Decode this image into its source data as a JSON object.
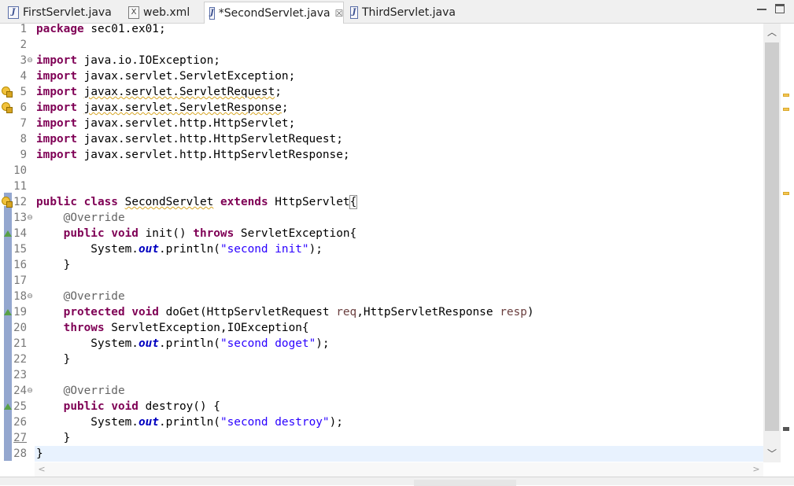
{
  "tabs": [
    {
      "label": "FirstServlet.java",
      "icon": "java-file-icon",
      "glyph": "J",
      "active": false
    },
    {
      "label": "web.xml",
      "icon": "xml-file-icon",
      "glyph": "X",
      "active": false
    },
    {
      "label": "*SecondServlet.java",
      "icon": "java-file-icon",
      "glyph": "J",
      "active": true,
      "close": "☒"
    },
    {
      "label": "ThirdServlet.java",
      "icon": "java-file-icon",
      "glyph": "J",
      "active": false
    }
  ],
  "code_lines": [
    {
      "n": "1",
      "html": "<span class=\"kw\">package</span> sec01.ex01;"
    },
    {
      "n": "2",
      "html": ""
    },
    {
      "n": "3",
      "html": "<span class=\"kw\">import</span> java.io.IOException;",
      "fold": "⊖"
    },
    {
      "n": "4",
      "html": "<span class=\"kw\">import</span> javax.servlet.ServletException;"
    },
    {
      "n": "5",
      "html": "<span class=\"kw\">import</span> <span class=\"sq\">javax.servlet.ServletRequest</span>;",
      "marker": "warning"
    },
    {
      "n": "6",
      "html": "<span class=\"kw\">import</span> <span class=\"sq\">javax.servlet.ServletResponse</span>;",
      "marker": "warning"
    },
    {
      "n": "7",
      "html": "<span class=\"kw\">import</span> javax.servlet.http.HttpServlet;"
    },
    {
      "n": "8",
      "html": "<span class=\"kw\">import</span> javax.servlet.http.HttpServletRequest;"
    },
    {
      "n": "9",
      "html": "<span class=\"kw\">import</span> javax.servlet.http.HttpServletResponse;"
    },
    {
      "n": "10",
      "html": ""
    },
    {
      "n": "11",
      "html": ""
    },
    {
      "n": "12",
      "html": "<span class=\"kw\">public</span> <span class=\"kw\">class</span> <span class=\"sq\">SecondServlet</span> <span class=\"kw\">extends</span> HttpServlet<span style=\"outline:1px solid #909090\">{</span>",
      "marker": "warning"
    },
    {
      "n": "13",
      "html": "    <span class=\"ann\">@Override</span>",
      "fold": "⊖"
    },
    {
      "n": "14",
      "html": "    <span class=\"kw\">public</span> <span class=\"kw\">void</span> init() <span class=\"kw\">throws</span> ServletException{",
      "marker": "override"
    },
    {
      "n": "15",
      "html": "        System.<span class=\"fld\">out</span>.println(<span class=\"str\">\"second init\"</span>);"
    },
    {
      "n": "16",
      "html": "    }"
    },
    {
      "n": "17",
      "html": ""
    },
    {
      "n": "18",
      "html": "    <span class=\"ann\">@Override</span>",
      "fold": "⊖"
    },
    {
      "n": "19",
      "html": "    <span class=\"kw\">protected</span> <span class=\"kw\">void</span> doGet(HttpServletRequest <span class=\"prm\">req</span>,HttpServletResponse <span class=\"prm\">resp</span>)",
      "marker": "override"
    },
    {
      "n": "20",
      "html": "    <span class=\"kw\">throws</span> ServletException,IOException{"
    },
    {
      "n": "21",
      "html": "        System.<span class=\"fld\">out</span>.println(<span class=\"str\">\"second doget\"</span>);"
    },
    {
      "n": "22",
      "html": "    }"
    },
    {
      "n": "23",
      "html": ""
    },
    {
      "n": "24",
      "html": "    <span class=\"ann\">@Override</span>",
      "fold": "⊖"
    },
    {
      "n": "25",
      "html": "    <span class=\"kw\">public</span> <span class=\"kw\">void</span> destroy() {",
      "marker": "override"
    },
    {
      "n": "26",
      "html": "        System.<span class=\"fld\">out</span>.println(<span class=\"str\">\"second destroy\"</span>);"
    },
    {
      "n": "27",
      "html": "    }"
    },
    {
      "n": "28",
      "html": "}",
      "current": true
    }
  ],
  "scroll": {
    "up": "︿",
    "down": "﹀",
    "left": "<",
    "right": ">"
  },
  "colors": {
    "keyword": "#7f0055",
    "string": "#2a00ff",
    "annotation": "#646464",
    "field": "#0000c0",
    "current_line": "#e8f2fe"
  }
}
